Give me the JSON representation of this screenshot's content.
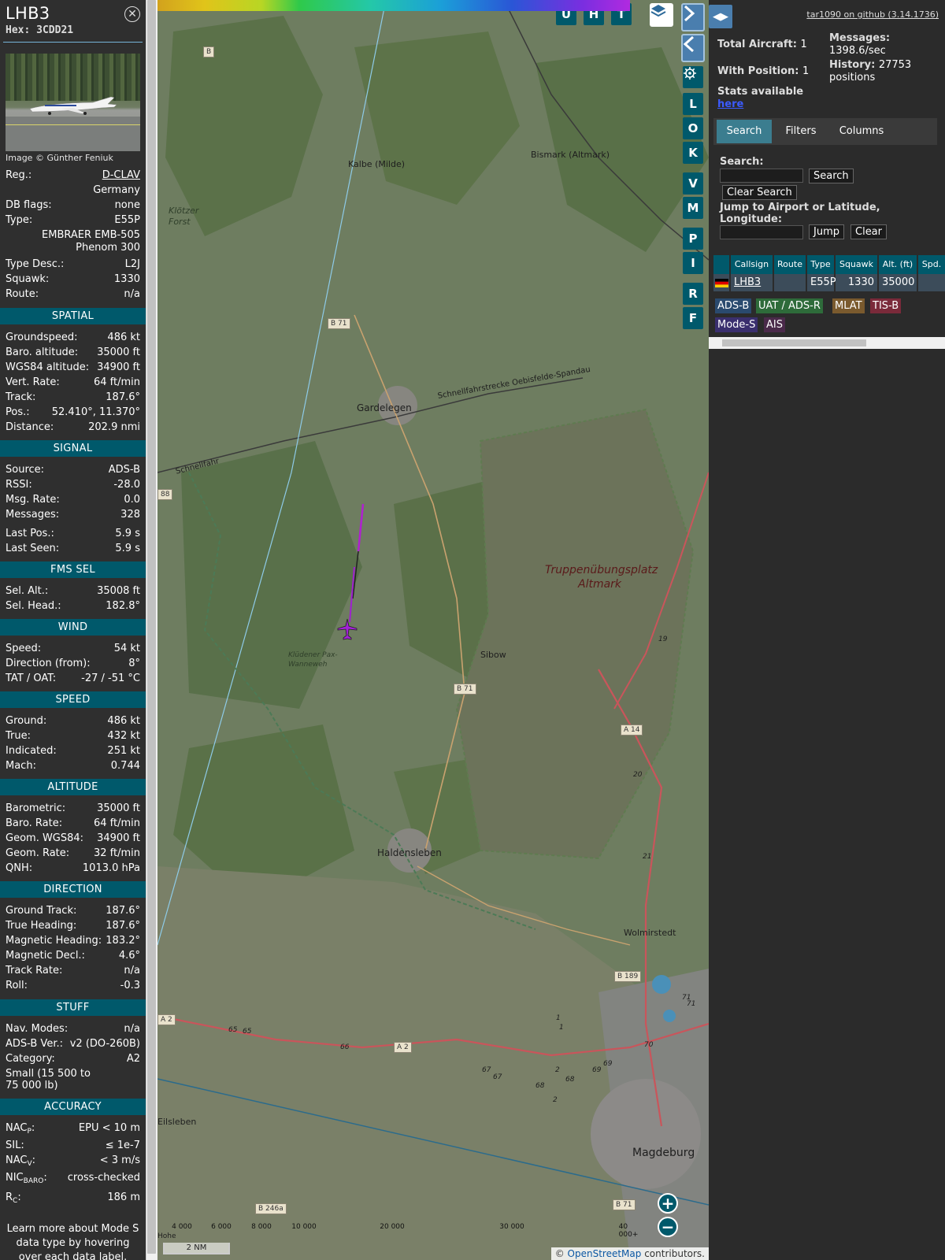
{
  "info": {
    "callsign": "LHB3",
    "hex_label": "Hex:",
    "hex": "3CDD21",
    "close_icon": "close-icon",
    "photo_credit": "Image © Günther Feniuk",
    "reg_label": "Reg.:",
    "reg": "D-CLAV",
    "country": "Germany",
    "dbflags_label": "DB flags:",
    "dbflags": "none",
    "type_label": "Type:",
    "type": "E55P",
    "type_full_1": "EMBRAER EMB-505",
    "type_full_2": "Phenom 300",
    "typedesc_label": "Type Desc.:",
    "typedesc": "L2J",
    "squawk_label": "Squawk:",
    "squawk": "1330",
    "route_label": "Route:",
    "route": "n/a",
    "sec_spatial": "SPATIAL",
    "groundspeed_label": "Groundspeed:",
    "groundspeed": "486 kt",
    "baro_alt_label": "Baro. altitude:",
    "baro_alt": "35000 ft",
    "wgs84_alt_label": "WGS84 altitude:",
    "wgs84_alt": "34900 ft",
    "vert_rate_label": "Vert. Rate:",
    "vert_rate": "64 ft/min",
    "track_label": "Track:",
    "track": "187.6°",
    "pos_label": "Pos.:",
    "pos": "52.410°, 11.370°",
    "distance_label": "Distance:",
    "distance": "202.9 nmi",
    "sec_signal": "SIGNAL",
    "source_label": "Source:",
    "source": "ADS-B",
    "rssi_label": "RSSI:",
    "rssi": "-28.0",
    "msgrate_label": "Msg. Rate:",
    "msgrate": "0.0",
    "messages_label": "Messages:",
    "messages": "328",
    "lastpos_label": "Last Pos.:",
    "lastpos": "5.9 s",
    "lastseen_label": "Last Seen:",
    "lastseen": "5.9 s",
    "sec_fms": "FMS SEL",
    "selalt_label": "Sel. Alt.:",
    "selalt": "35008 ft",
    "selhead_label": "Sel. Head.:",
    "selhead": "182.8°",
    "sec_wind": "WIND",
    "windspeed_label": "Speed:",
    "windspeed": "54 kt",
    "winddir_label": "Direction (from):",
    "winddir": "8°",
    "tat_label": "TAT / OAT:",
    "tat": "-27 / -51 °C",
    "sec_speed": "SPEED",
    "spd_ground_label": "Ground:",
    "spd_ground": "486 kt",
    "spd_true_label": "True:",
    "spd_true": "432 kt",
    "spd_ind_label": "Indicated:",
    "spd_ind": "251 kt",
    "mach_label": "Mach:",
    "mach": "0.744",
    "sec_altitude": "ALTITUDE",
    "alt_baro_label": "Barometric:",
    "alt_baro": "35000 ft",
    "alt_barorate_label": "Baro. Rate:",
    "alt_barorate": "64 ft/min",
    "alt_geom_label": "Geom. WGS84:",
    "alt_geom": "34900 ft",
    "alt_geomrate_label": "Geom. Rate:",
    "alt_geomrate": "32 ft/min",
    "qnh_label": "QNH:",
    "qnh": "1013.0 hPa",
    "sec_direction": "DIRECTION",
    "gtrack_label": "Ground Track:",
    "gtrack": "187.6°",
    "thead_label": "True Heading:",
    "thead": "187.6°",
    "mhead_label": "Magnetic Heading:",
    "mhead": "183.2°",
    "mdecl_label": "Magnetic Decl.:",
    "mdecl": "4.6°",
    "trackrate_label": "Track Rate:",
    "trackrate": "n/a",
    "roll_label": "Roll:",
    "roll": "-0.3",
    "sec_stuff": "STUFF",
    "navmodes_label": "Nav. Modes:",
    "navmodes": "n/a",
    "adsbver_label": "ADS-B Ver.:",
    "adsbver": "v2 (DO-260B)",
    "category_label": "Category:",
    "category": "A2",
    "category_desc_1": "Small (15 500 to",
    "category_desc_2": "75 000 lb)",
    "sec_accuracy": "ACCURACY",
    "nacp_label": "NAC",
    "nacp_sub": "P",
    "nacp": "EPU < 10 m",
    "sil_label": "SIL:",
    "sil": "≤ 1e-7",
    "nacv_label": "NAC",
    "nacv_sub": "V",
    "nacv": "< 3 m/s",
    "nicbaro_label": "NIC",
    "nicbaro_sub": "BARO",
    "nicbaro": "cross-checked",
    "rc_label": "R",
    "rc_sub": "C",
    "rc": "186 m",
    "footer_note": "Learn more about Mode S data type by hovering over each data label."
  },
  "map": {
    "places": {
      "kalbe": "Kalbe (Milde)",
      "bismark": "Bismark (Altmark)",
      "klotzer": "Klötzer Forst",
      "gardelegen": "Gardelegen",
      "schnellfahr": "Schnellfahrstrecke Oebisfelde-Spandau",
      "schnellfahr2": "Schnellfahr",
      "truppen1": "Truppenübungsplatz",
      "truppen2": "Altmark",
      "kludener": "Klüdener Pax-Wanneweh",
      "sibow": "Sibow",
      "haldensleben": "Haldensleben",
      "wolmirstedt": "Wolmirstedt",
      "eilsleben": "Eilsleben",
      "magdeburg": "Magdeburg",
      "hohe": "Hohe"
    },
    "shields": {
      "b": "B",
      "b71a": "B 71",
      "b71b": "B 71",
      "a14": "A 14",
      "b189": "B 189",
      "a2a": "A 2",
      "a2b": "A 2",
      "b246a": "B 246a",
      "b71c": "B 71",
      "s88": "88"
    },
    "km_markers": [
      "19",
      "20",
      "21",
      "65",
      "65",
      "66",
      "67",
      "67",
      "68",
      "68",
      "69",
      "69",
      "70",
      "71",
      "71",
      "1",
      "1",
      "2",
      "2"
    ],
    "buttons": [
      "U",
      "H",
      "T"
    ],
    "side_buttons": [
      "L",
      "O",
      "K",
      "V",
      "M",
      "P",
      "I",
      "R",
      "F"
    ],
    "scale_label": "2 NM",
    "legend_labels": [
      "4 000",
      "6 000",
      "8 000",
      "10 000",
      "20 000",
      "30 000",
      "40 000+"
    ],
    "attribution_prefix": "© ",
    "attribution_link": "OpenStreetMap",
    "attribution_suffix": " contributors.",
    "zoom_in": "+",
    "zoom_out": "−",
    "icons": {
      "layers": "layers-icon",
      "next": "chevron-right-icon",
      "prev": "chevron-left-icon",
      "settings": "gear-icon",
      "aircraft": "aircraft-icon"
    }
  },
  "right": {
    "github_link": "tar1090 on github (3.14.1736)",
    "total_label": "Total Aircraft:",
    "total": "1",
    "withpos_label": "With Position:",
    "withpos": "1",
    "messages_label": "Messages:",
    "messages": "1398.6/sec",
    "history_label": "History:",
    "history_1": "27753",
    "history_2": "positions",
    "stats_label": "Stats available",
    "stats_link": "here",
    "tabs": [
      "Search",
      "Filters",
      "Columns"
    ],
    "search_label": "Search:",
    "search_button": "Search",
    "clear_search_button": "Clear Search",
    "jump_label_1": "Jump to Airport or Latitude,",
    "jump_label_2": "Longitude:",
    "jump_button": "Jump",
    "clear_button": "Clear",
    "table_headers": [
      "",
      "Callsign",
      "Route",
      "Type",
      "Squawk",
      "Alt. (ft)",
      "Spd."
    ],
    "table_row": {
      "callsign": "LHB3",
      "route": "",
      "type": "E55P",
      "squawk": "1330",
      "alt": "35000",
      "spd": ""
    },
    "badges": [
      "ADS-B",
      "UAT / ADS-R",
      "MLAT",
      "TIS-B",
      "Mode-S",
      "AIS"
    ],
    "badge_colors": [
      "#2a4a6e",
      "#2e6b3a",
      "#7a5a2e",
      "#7a2a3a",
      "#3a2f6e",
      "#4a2a4a"
    ]
  }
}
